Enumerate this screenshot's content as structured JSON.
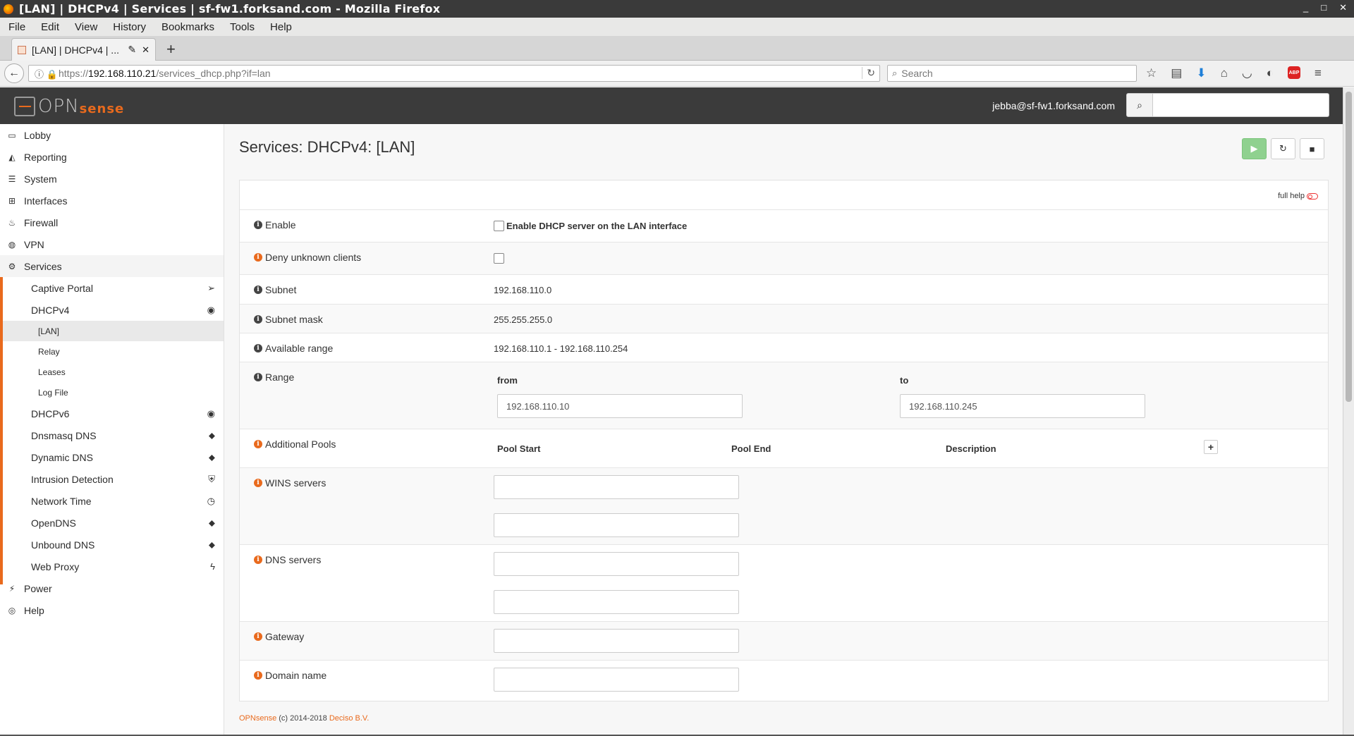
{
  "window": {
    "title": "[LAN] | DHCPv4 | Services | sf-fw1.forksand.com - Mozilla Firefox",
    "controls": [
      "_",
      "□",
      "✕"
    ]
  },
  "menubar": [
    "File",
    "Edit",
    "View",
    "History",
    "Bookmarks",
    "Tools",
    "Help"
  ],
  "tab": {
    "title": "[LAN] | DHCPv4 | ...",
    "close": "✕",
    "new": "+"
  },
  "nav": {
    "url_scheme": "https://",
    "url_host": "192.168.110.21",
    "url_path": "/services_dhcp.php?if=lan",
    "search_placeholder": "Search"
  },
  "header": {
    "logo_left": "OPN",
    "logo_right": "sense",
    "user": "jebba@sf-fw1.forksand.com"
  },
  "sidebar": {
    "top": [
      {
        "label": "Lobby",
        "icon": "laptop-icon",
        "glyph": "▭"
      },
      {
        "label": "Reporting",
        "icon": "area-chart-icon",
        "glyph": "◭"
      },
      {
        "label": "System",
        "icon": "server-icon",
        "glyph": "☰"
      },
      {
        "label": "Interfaces",
        "icon": "sitemap-icon",
        "glyph": "⊞"
      },
      {
        "label": "Firewall",
        "icon": "fire-icon",
        "glyph": "♨"
      },
      {
        "label": "VPN",
        "icon": "globe-icon",
        "glyph": "◍"
      },
      {
        "label": "Services",
        "icon": "cog-icon",
        "glyph": "⚙"
      }
    ],
    "services": [
      {
        "label": "Captive Portal",
        "icon": "paper-plane-icon",
        "glyph": "➢"
      },
      {
        "label": "DHCPv4",
        "icon": "bullseye-icon",
        "glyph": "◉"
      },
      {
        "label": "DHCPv6",
        "icon": "bullseye-icon",
        "glyph": "◉"
      },
      {
        "label": "Dnsmasq DNS",
        "icon": "tags-icon",
        "glyph": "⬥"
      },
      {
        "label": "Dynamic DNS",
        "icon": "tags-icon",
        "glyph": "⬥"
      },
      {
        "label": "Intrusion Detection",
        "icon": "shield-icon",
        "glyph": "⛨"
      },
      {
        "label": "Network Time",
        "icon": "clock-icon",
        "glyph": "◷"
      },
      {
        "label": "OpenDNS",
        "icon": "tags-icon",
        "glyph": "⬥"
      },
      {
        "label": "Unbound DNS",
        "icon": "tags-icon",
        "glyph": "⬥"
      },
      {
        "label": "Web Proxy",
        "icon": "bolt-icon",
        "glyph": "ϟ"
      }
    ],
    "dhcp_sub": [
      "[LAN]",
      "Relay",
      "Leases",
      "Log File"
    ],
    "bottom": [
      {
        "label": "Power",
        "icon": "plug-icon",
        "glyph": "⚡"
      },
      {
        "label": "Help",
        "icon": "life-ring-icon",
        "glyph": "◎"
      }
    ]
  },
  "page": {
    "title": "Services: DHCPv4: [LAN]",
    "full_help": "full help"
  },
  "form": {
    "enable_label": "Enable",
    "enable_text": "Enable DHCP server on the LAN interface",
    "deny_label": "Deny unknown clients",
    "subnet_label": "Subnet",
    "subnet_value": "192.168.110.0",
    "mask_label": "Subnet mask",
    "mask_value": "255.255.255.0",
    "avail_label": "Available range",
    "avail_value": "192.168.110.1 - 192.168.110.254",
    "range_label": "Range",
    "range_from_label": "from",
    "range_to_label": "to",
    "range_from": "192.168.110.10",
    "range_to": "192.168.110.245",
    "pools_label": "Additional Pools",
    "pool_start": "Pool Start",
    "pool_end": "Pool End",
    "pool_desc": "Description",
    "wins_label": "WINS servers",
    "dns_label": "DNS servers",
    "gateway_label": "Gateway",
    "domain_label": "Domain name"
  },
  "footer": {
    "brand": "OPNsense",
    "middle": "(c) 2014-2018",
    "company": "Deciso B.V."
  },
  "colors": {
    "accent": "#e96a1d",
    "header": "#3b3b3b",
    "play": "#8fd18f"
  }
}
